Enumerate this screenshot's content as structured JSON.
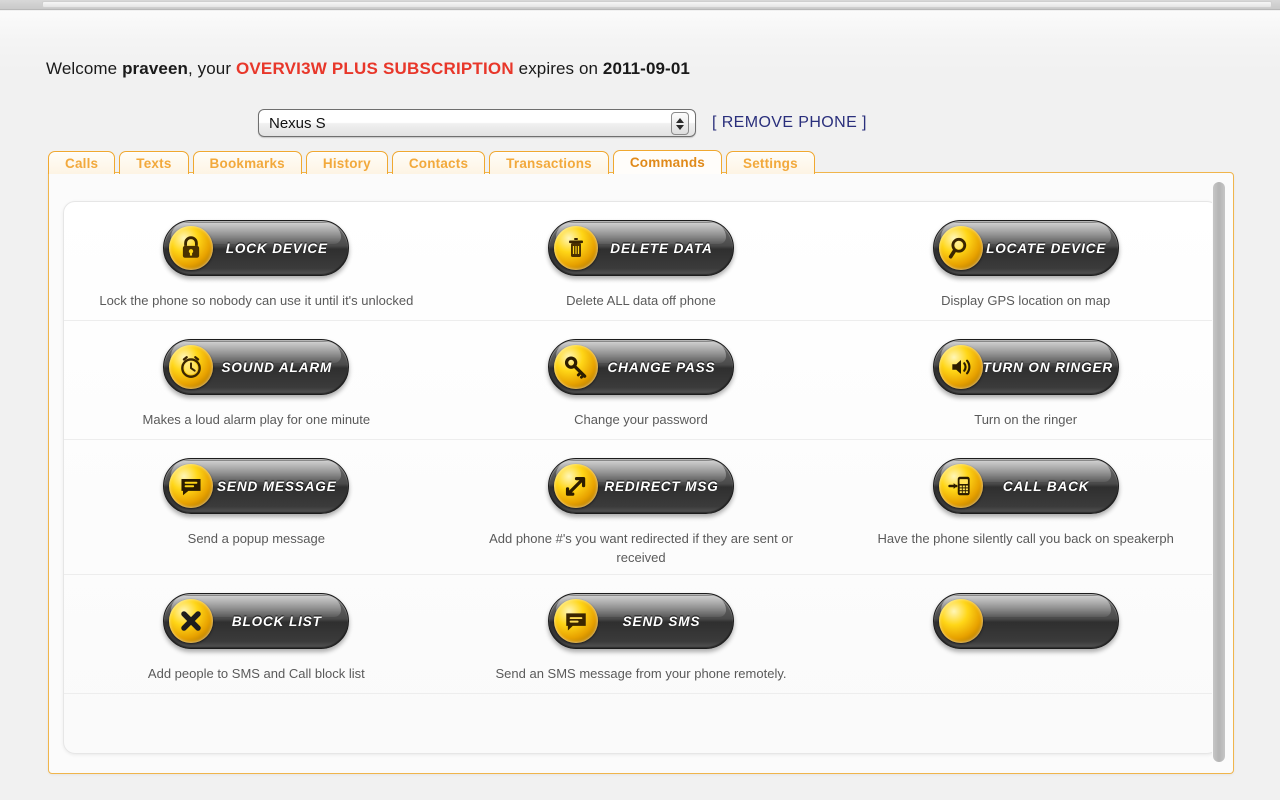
{
  "welcome": {
    "prefix": "Welcome ",
    "username": "praveen",
    "middle": ", your ",
    "subscription": "OVERVI3W PLUS SUBSCRIPTION",
    "expires_label": " expires on ",
    "expiry_date": "2011-09-01"
  },
  "phone_bar": {
    "selected_phone": "Nexus S",
    "remove_phone_label": "[ REMOVE PHONE ]"
  },
  "tabs": [
    {
      "label": "Calls",
      "active": false
    },
    {
      "label": "Texts",
      "active": false
    },
    {
      "label": "Bookmarks",
      "active": false
    },
    {
      "label": "History",
      "active": false
    },
    {
      "label": "Contacts",
      "active": false
    },
    {
      "label": "Transactions",
      "active": false
    },
    {
      "label": "Commands",
      "active": true
    },
    {
      "label": "Settings",
      "active": false
    }
  ],
  "commands": [
    [
      {
        "label": "LOCK DEVICE",
        "icon": "padlock-icon",
        "desc": "Lock the phone so nobody can use it until it's unlocked"
      },
      {
        "label": "DELETE DATA",
        "icon": "trash-can-icon",
        "desc": "Delete ALL data off phone"
      },
      {
        "label": "LOCATE DEVICE",
        "icon": "magnifier-icon",
        "desc": "Display GPS location on map"
      }
    ],
    [
      {
        "label": "SOUND ALARM",
        "icon": "alarm-clock-icon",
        "desc": "Makes a loud alarm play for one minute"
      },
      {
        "label": "CHANGE PASS",
        "icon": "key-icon",
        "desc": "Change your password"
      },
      {
        "label": "TURN ON RINGER",
        "icon": "speaker-icon",
        "desc": "Turn on the ringer"
      }
    ],
    [
      {
        "label": "SEND MESSAGE",
        "icon": "speech-bubble-icon",
        "desc": "Send a popup message"
      },
      {
        "label": "REDIRECT MSG",
        "icon": "arrow-redirect-icon",
        "desc": "Add phone #'s you want redirected if they are sent or received"
      },
      {
        "label": "CALL BACK",
        "icon": "mobile-phone-icon",
        "desc": "Have the phone silently call you back on speakerph"
      }
    ],
    [
      {
        "label": "BLOCK LIST",
        "icon": "x-cross-icon",
        "desc": "Add people to SMS and Call block list"
      },
      {
        "label": "SEND SMS",
        "icon": "sms-bubble-icon",
        "desc": "Send an SMS message from your phone remotely."
      },
      {
        "label": "",
        "icon": "blank-gold-icon",
        "desc": ""
      }
    ]
  ],
  "colors": {
    "subscription_red": "#e8372a",
    "tab_orange": "#f2a93c",
    "tab_active_orange": "#e08a1a",
    "frame_border": "#f0b54c",
    "link_navy": "#2a2f7c",
    "icon_gold": "#ffd617"
  }
}
